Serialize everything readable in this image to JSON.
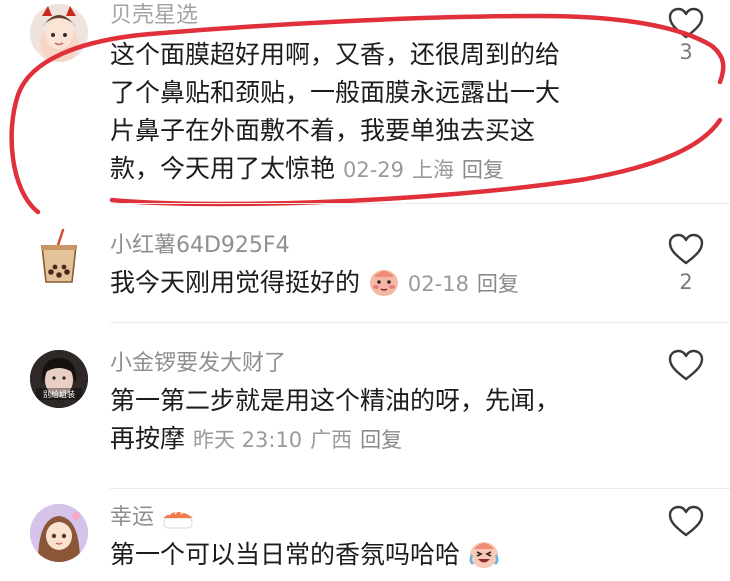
{
  "comments": [
    {
      "username": "贝壳星选",
      "lines": [
        "这个面膜超好用啊，又香，还很周到的给",
        "了个鼻贴和颈贴，一般面膜永远露出一大",
        "片鼻子在外面敷不着，我要单独去买这",
        "款，今天用了太惊艳"
      ],
      "date": "02-29",
      "location": "上海",
      "reply": "回复",
      "likes": "3"
    },
    {
      "username": "小红薯64D925F4",
      "lines": [
        "我今天刚用觉得挺好的"
      ],
      "emoji": "blushing-face-icon",
      "date": "02-18",
      "location": "",
      "reply": "回复",
      "likes": "2"
    },
    {
      "username": "小金锣要发大财了",
      "avatar_text": "别给姐装",
      "lines": [
        "第一第二步就是用这个精油的呀，先闻，",
        "再按摩"
      ],
      "date": "昨天 23:10",
      "location": "广西",
      "reply": "回复",
      "likes": ""
    },
    {
      "username": "幸运",
      "name_emoji": "sushi-icon",
      "lines": [
        "第一个可以当日常的香氛吗哈哈"
      ],
      "emoji": "crying-laughing-face-icon",
      "likes": ""
    }
  ],
  "colors": {
    "annotation_red": "#e0303a",
    "meta_gray": "#9a9a9a",
    "name_gray": "#8f8f8f"
  }
}
